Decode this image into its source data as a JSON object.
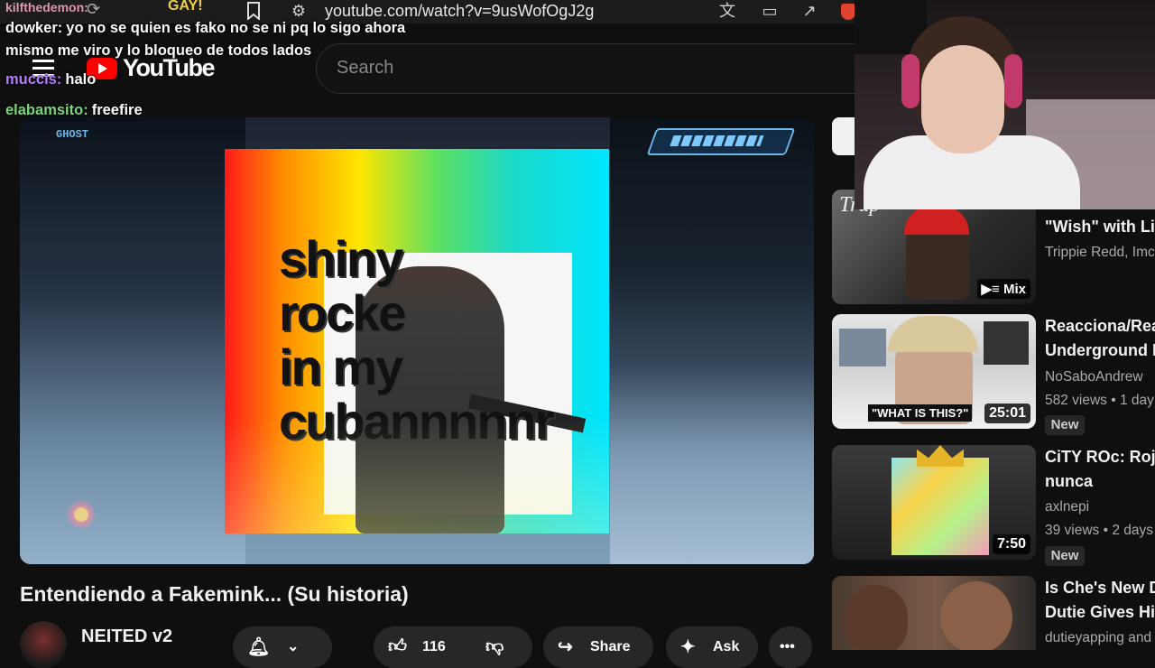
{
  "browser": {
    "url": "youtube.com/watch?v=9usWofOgJ2g",
    "top_left_fragment": "kilfthedemon:"
  },
  "youtube": {
    "logo_text": "YouTube",
    "search_placeholder": "Search"
  },
  "chat": [
    {
      "user": "dowker:",
      "user_color": "#ffffff",
      "lines": [
        "yo no se quien es fako no se ni pq lo sigo ahora",
        "mismo me viro y lo bloqueo de todos lados"
      ]
    },
    {
      "user": "muccis:",
      "user_color": "#b57cff",
      "lines": [
        "halo"
      ]
    },
    {
      "user": "elabamsito:",
      "user_color": "#7ad67a",
      "lines": [
        "freefire"
      ]
    }
  ],
  "video": {
    "overlay_text": "shiny\nrocke\nin my\ncubannnnnr",
    "title": "Entendiendo a Fakemink... (Su historia)",
    "hud_label": "GHOST"
  },
  "channel": {
    "name": "NEITED v2"
  },
  "actions": {
    "likes": "116",
    "share_label": "Share",
    "ask_label": "Ask",
    "more_label": "•••"
  },
  "recommendations": [
    {
      "title1": "\"Wish\" with Liv",
      "title2": "",
      "meta1": "Trippie Redd, Imc",
      "meta2": "",
      "badge": "Mix",
      "duration": "",
      "new": ""
    },
    {
      "title1": "Reacciona/Rea",
      "title2": "Underground L",
      "meta1": "NoSaboAndrew",
      "meta2": "582 views • 1 day",
      "badge": "",
      "duration": "25:01",
      "new": "New"
    },
    {
      "title1": "CiTY ROc: Roju",
      "title2": "nunca",
      "meta1": "axlnepi",
      "meta2": "39 views • 2 days",
      "badge": "",
      "duration": "7:50",
      "new": "New"
    },
    {
      "title1": "Is Che's New D",
      "title2": "Dutie Gives His",
      "meta1": "dutieyapping and",
      "meta2": "",
      "badge": "",
      "duration": "",
      "new": ""
    }
  ],
  "thumb_texts": {
    "rec1_brand": "Trap",
    "rec2_caption": "\"WHAT IS THIS?\""
  }
}
